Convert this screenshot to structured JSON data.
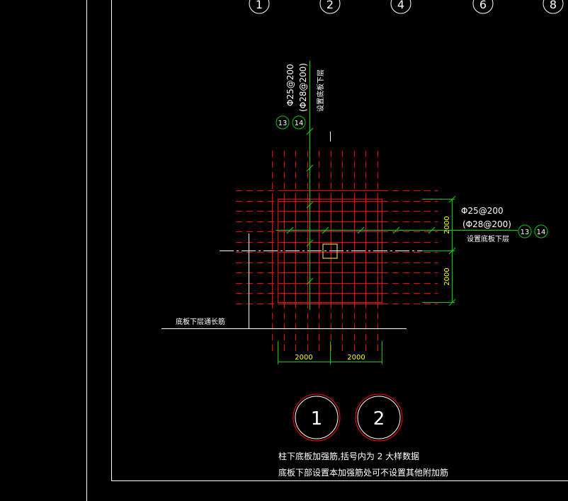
{
  "grid_axes": [
    "1",
    "2",
    "4",
    "6",
    "8"
  ],
  "vertical_callout": {
    "main_rebar": "Φ25@200",
    "alt_rebar": "(Φ28@200)",
    "note": "设置底板下层",
    "circle_a": "13",
    "circle_b": "14"
  },
  "horizontal_callout": {
    "main_rebar": "Φ25@200",
    "alt_rebar": "(Φ28@200)",
    "note": "设置底板下层",
    "circle_a": "13",
    "circle_b": "14"
  },
  "dimensions": {
    "right_upper": "2000",
    "right_lower": "2000",
    "bottom_left": "2000",
    "bottom_right": "2000"
  },
  "base_label": "底板下层通长筋",
  "detail_circles": [
    "1",
    "2"
  ],
  "notes": {
    "line1": "柱下底板加强筋,括号内为 2  大样数据",
    "line2": "底板下部设置本加强筋处可不设置其他附加筋"
  },
  "colors": {
    "background": "#000000",
    "rebar": "#ff0000",
    "leader": "#00cc00",
    "dimension": "#00cc00",
    "text": "#ffffff",
    "dim_text": "#ffff00",
    "frame": "#ffffff"
  }
}
